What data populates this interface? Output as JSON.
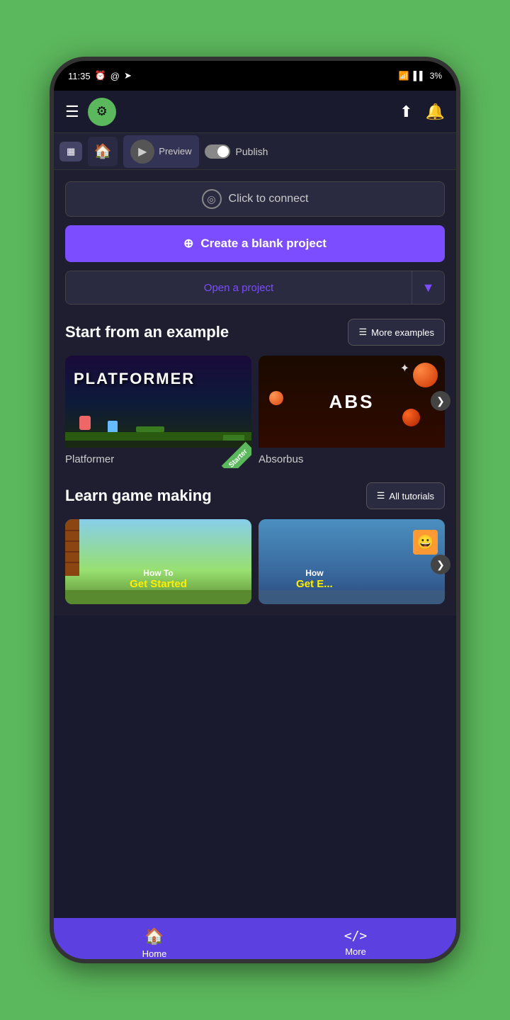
{
  "phone": {
    "statusBar": {
      "time": "11:35",
      "icons_left": [
        "clock",
        "at-sign",
        "location"
      ],
      "icons_right": [
        "wifi",
        "signal",
        "battery"
      ],
      "battery": "3%"
    }
  },
  "header": {
    "menu_label": "☰",
    "logo_emoji": "⚙",
    "share_label": "⬆",
    "bell_label": "🔔"
  },
  "toolbar": {
    "home_icon": "🏠",
    "layers_icon": "▦",
    "play_label": "▶",
    "preview_label": "Preview",
    "toggle": "",
    "publish_label": "Publish"
  },
  "content": {
    "connect_icon": "◎",
    "connect_label": "Click to connect",
    "create_label": "Create a blank project",
    "create_icon": "⊕",
    "open_label": "Open a project",
    "open_dropdown_icon": "▼",
    "examples_section": {
      "title": "Start from an example",
      "more_btn": "More examples",
      "items": [
        {
          "name": "Platformer",
          "label": "Platformer",
          "badge": "Starter"
        },
        {
          "name": "Absorbus",
          "label": "Absorbus"
        }
      ]
    },
    "tutorials_section": {
      "title": "Learn game making",
      "all_btn": "All tutorials",
      "items": [
        {
          "line1": "How To",
          "line2": "Get Started"
        },
        {
          "line1": "How",
          "line2": "Get E..."
        }
      ]
    }
  },
  "bottomNav": {
    "items": [
      {
        "icon": "🏠",
        "label": "Home"
      },
      {
        "icon": "</>",
        "label": "More"
      }
    ]
  },
  "androidNav": {
    "back": "❮",
    "home": "⬜",
    "recent": "|||"
  }
}
